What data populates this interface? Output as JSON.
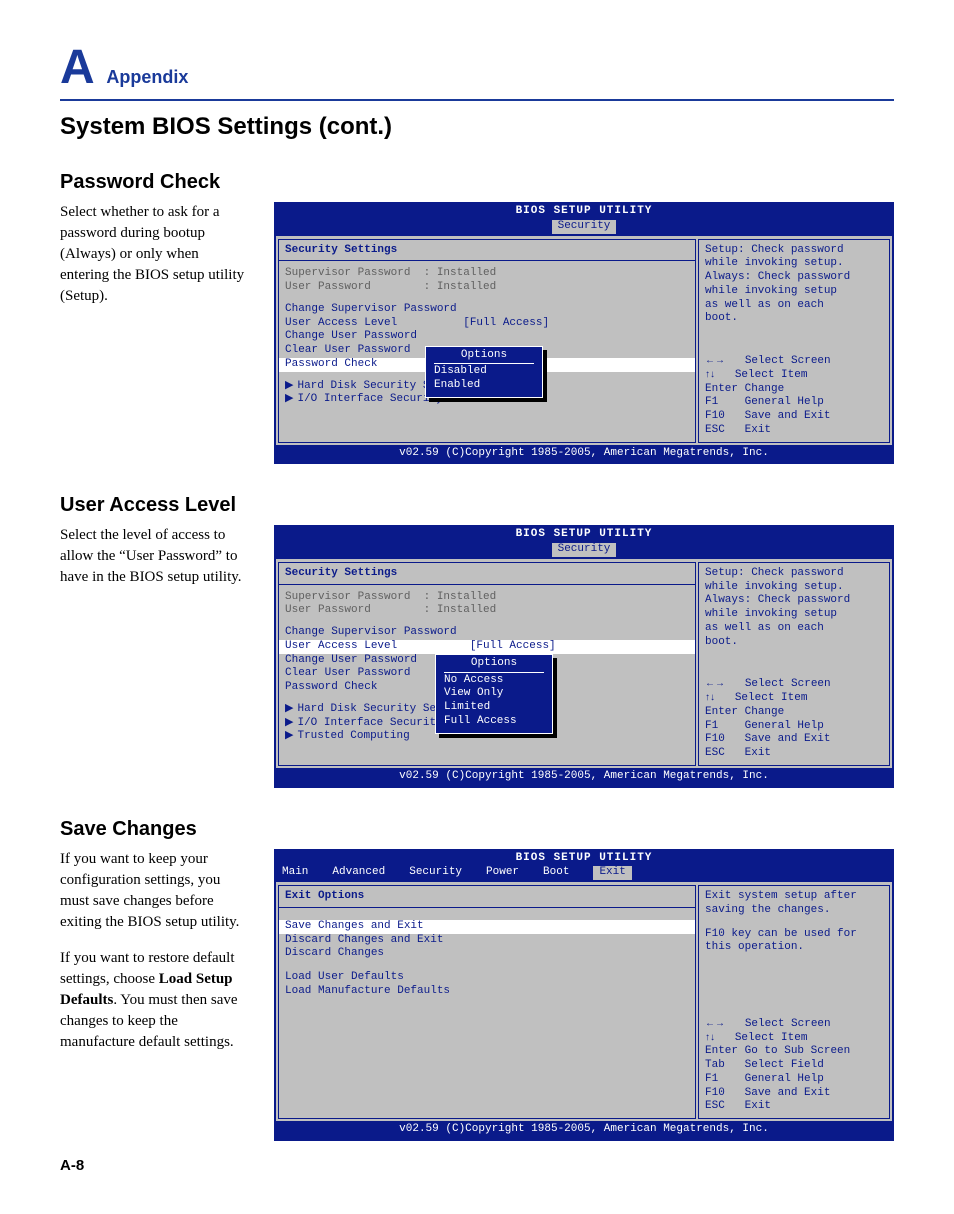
{
  "header": {
    "letter": "A",
    "word": "Appendix"
  },
  "page_title": "System BIOS Settings (cont.)",
  "page_number": "A-8",
  "bios_common": {
    "title": "BIOS SETUP UTILITY",
    "footer": "v02.59 (C)Copyright 1985-2005, American Megatrends, Inc.",
    "options_label": "Options"
  },
  "security_help": {
    "l1": "Setup: Check password",
    "l2": "while invoking setup.",
    "l3": "Always: Check password",
    "l4": "while invoking setup",
    "l5": "as well as on each",
    "l6": "boot."
  },
  "keys_sec": {
    "k1a": "←→",
    "k1b": "Select Screen",
    "k2a": "↑↓",
    "k2b": "Select Item",
    "k3a": "Enter",
    "k3b": "Change",
    "k4a": "F1",
    "k4b": "General Help",
    "k5a": "F10",
    "k5b": "Save and Exit",
    "k6a": "ESC",
    "k6b": "Exit"
  },
  "sections": {
    "pwd": {
      "heading": "Password Check",
      "desc": "Select whether to ask for a password during bootup (Always) or only when entering the BIOS setup utility (Setup).",
      "tab": "Security",
      "panel_title": "Security Settings",
      "lines": {
        "sup": "Supervisor Password  : Installed",
        "usr": "User Password        : Installed",
        "csp": "Change Supervisor Password",
        "ual": "User Access Level          [Full Access]",
        "cup": "Change User Password",
        "clp": "Clear User Password",
        "pc": "Password Check",
        "hds": "Hard Disk Security Se",
        "iis": "I/O Interface Security"
      },
      "options": [
        "Disabled",
        "Enabled"
      ]
    },
    "ual": {
      "heading": "User Access Level",
      "desc": "Select the level of access to allow the “User Password” to have in the BIOS setup utility.",
      "tab": "Security",
      "panel_title": "Security Settings",
      "lines": {
        "sup": "Supervisor Password  : Installed",
        "usr": "User Password        : Installed",
        "csp": "Change Supervisor Password",
        "ual": "User Access Level           [Full Access]",
        "cup": "Change User Password",
        "clp": "Clear User Password",
        "pc": "Password Check",
        "hds": "Hard Disk Security Se",
        "iis": "I/O Interface Securit",
        "tc": "Trusted Computing"
      },
      "options": [
        "No Access",
        "View Only",
        "Limited",
        "Full Access"
      ]
    },
    "save": {
      "heading": "Save Changes",
      "desc1": "If you want to keep your configuration settings, you must save changes before exiting the BIOS setup utility.",
      "desc2a": "If you want to restore default settings, choose ",
      "desc2b": "Load Setup Defaults",
      "desc2c": ". You must then save changes to keep the manufacture default settings.",
      "tabs": [
        "Main",
        "Advanced",
        "Security",
        "Power",
        "Boot",
        "Exit"
      ],
      "panel_title": "Exit Options",
      "lines": {
        "sce": "Save Changes and Exit",
        "dce": "Discard Changes and Exit",
        "dc": "Discard Changes",
        "lud": "Load User Defaults",
        "lmd": "Load Manufacture Defaults"
      },
      "help": {
        "l1": "Exit system setup after",
        "l2": "saving the changes.",
        "l3": "F10 key can be used for",
        "l4": "this operation."
      },
      "keys": {
        "k1a": "←→",
        "k1b": "Select Screen",
        "k2a": "↑↓",
        "k2b": "Select Item",
        "k3a": "Enter",
        "k3b": "Go to Sub Screen",
        "k4a": "Tab",
        "k4b": "Select Field",
        "k5a": "F1",
        "k5b": "General Help",
        "k6a": "F10",
        "k6b": "Save and Exit",
        "k7a": "ESC",
        "k7b": "Exit"
      }
    }
  }
}
